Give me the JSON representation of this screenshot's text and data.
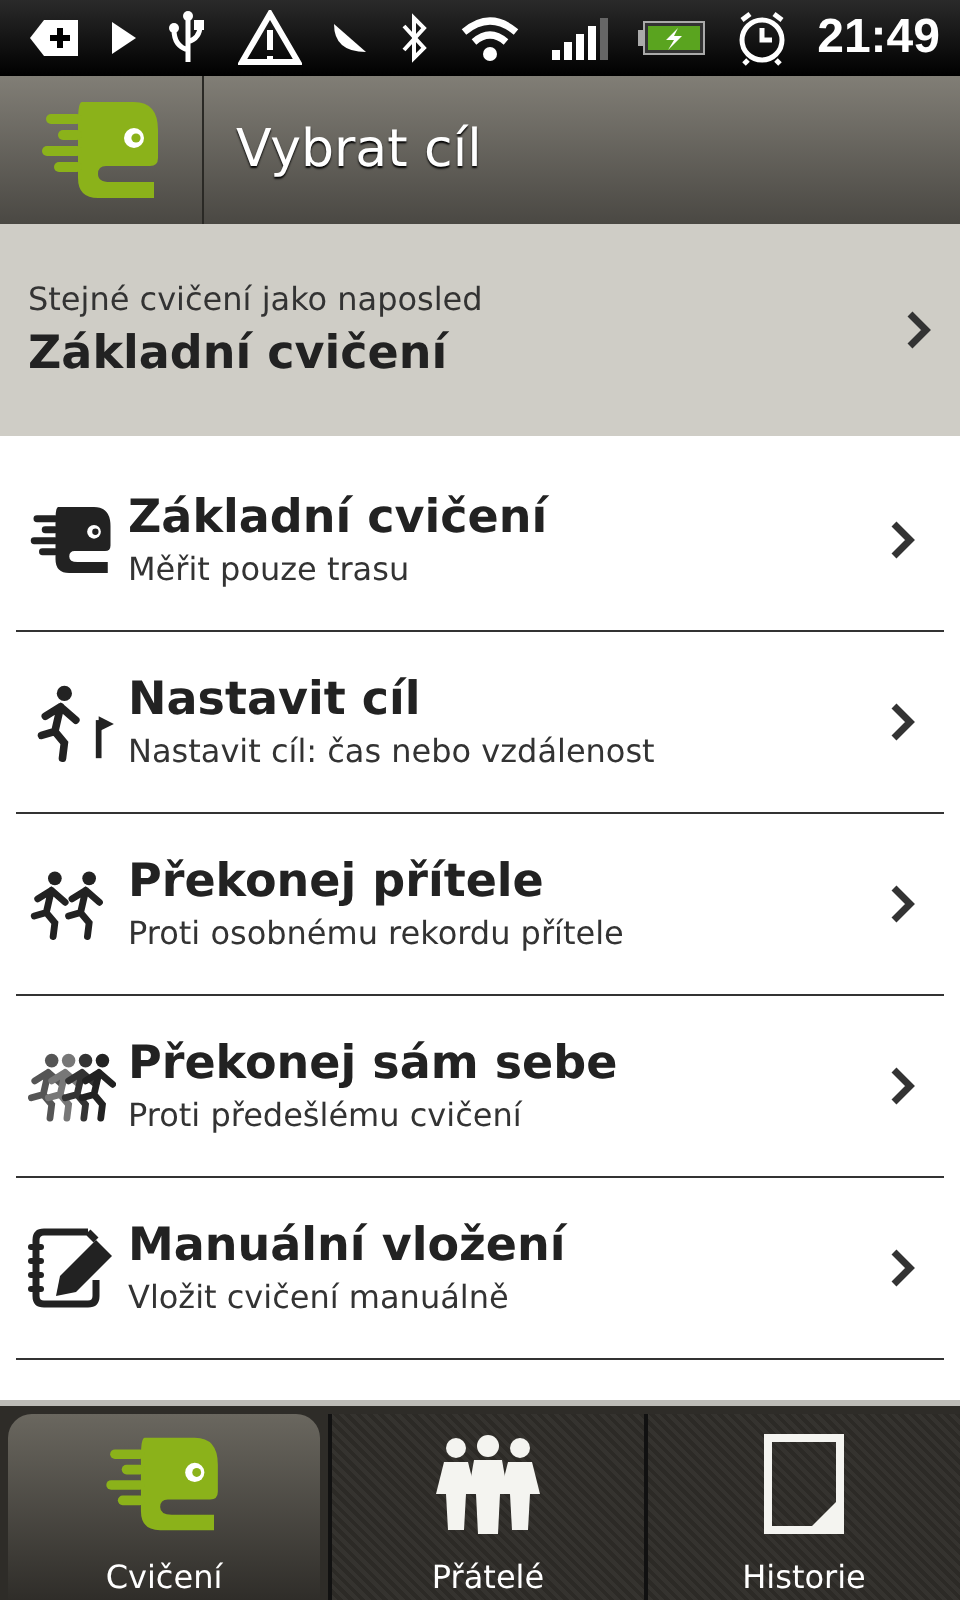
{
  "status_bar": {
    "time": "21:49"
  },
  "header": {
    "title": "Vybrat cíl"
  },
  "recent": {
    "caption": "Stejné cvičení jako naposled",
    "title": "Základní cvičení"
  },
  "goals": [
    {
      "kind": "basic",
      "title": "Základní cvičení",
      "subtitle": "Měřit pouze trasu"
    },
    {
      "kind": "goal",
      "title": "Nastavit cíl",
      "subtitle": "Nastavit cíl: čas nebo vzdálenost"
    },
    {
      "kind": "friend",
      "title": "Překonej přítele",
      "subtitle": "Proti osobnému rekordu přítele"
    },
    {
      "kind": "self",
      "title": "Překonej sám sebe",
      "subtitle": "Proti předešlému cvičení"
    },
    {
      "kind": "manual",
      "title": "Manuální vložení",
      "subtitle": "Vložit cvičení manuálně"
    }
  ],
  "tabs": [
    {
      "kind": "workout",
      "label": "Cvičení",
      "selected": true
    },
    {
      "kind": "friends",
      "label": "Přátelé",
      "selected": false
    },
    {
      "kind": "history",
      "label": "Historie",
      "selected": false
    }
  ]
}
